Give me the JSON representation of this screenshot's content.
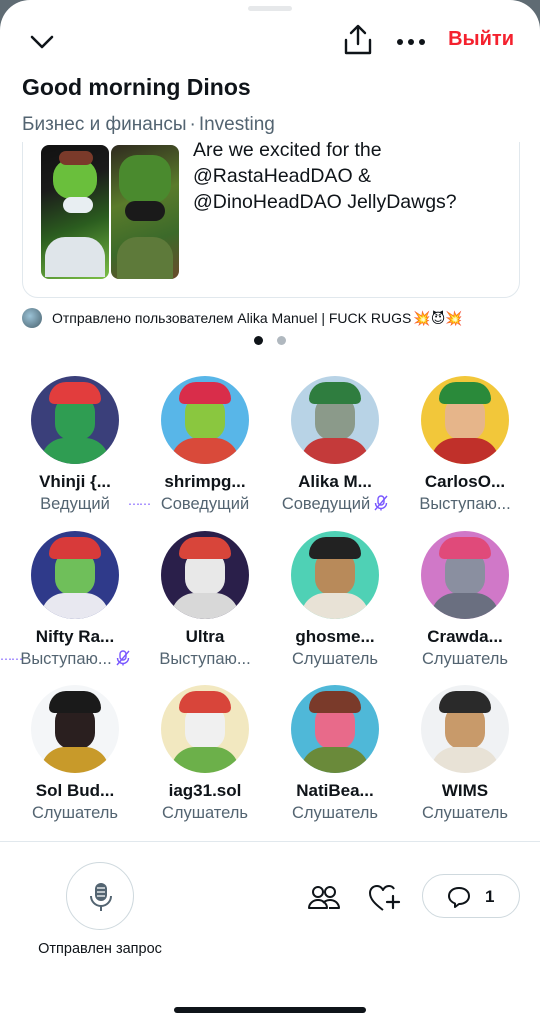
{
  "header": {
    "leave_label": "Выйти"
  },
  "space": {
    "title": "Good morning Dinos",
    "category": "Бизнес и финансы",
    "separator": "·",
    "topic": "Investing"
  },
  "pinned": {
    "text": "Are we excited for the @RastaHeadDAO & @DinoHeadDAO JellyDawgs?",
    "sent_by": "Отправлено пользователем Alika Manuel | FUCK RUGS",
    "emoji": "💥😈💥"
  },
  "carousel": {
    "pages": 2,
    "active": 1
  },
  "participants": [
    {
      "name": "Vhinji {...",
      "role": "Ведущий",
      "speaking": false,
      "muted": false
    },
    {
      "name": "shrimpg...",
      "role": "Соведущий",
      "speaking": true,
      "muted": false
    },
    {
      "name": "Alika M...",
      "role": "Соведущий",
      "speaking": false,
      "muted": true
    },
    {
      "name": "CarlosO...",
      "role": "Выступаю...",
      "speaking": false,
      "muted": false
    },
    {
      "name": "Nifty Ra...",
      "role": "Выступаю...",
      "speaking": true,
      "muted": true
    },
    {
      "name": "Ultra",
      "role": "Выступаю...",
      "speaking": false,
      "muted": false
    },
    {
      "name": "ghosme...",
      "role": "Слушатель",
      "speaking": false,
      "muted": false
    },
    {
      "name": "Crawda...",
      "role": "Слушатель",
      "speaking": false,
      "muted": false
    },
    {
      "name": "Sol Bud...",
      "role": "Слушатель",
      "speaking": false,
      "muted": false
    },
    {
      "name": "iag31.sol",
      "role": "Слушатель",
      "speaking": false,
      "muted": false
    },
    {
      "name": "NatiBea...",
      "role": "Слушатель",
      "speaking": false,
      "muted": false
    },
    {
      "name": "WIMS",
      "role": "Слушатель",
      "speaking": false,
      "muted": false
    }
  ],
  "footer": {
    "mic_label": "Отправлен запрос",
    "reply_count": "1"
  },
  "colors": {
    "leave_red": "#f4212e",
    "speaking_purple": "#7856ff",
    "secondary_text": "#536471"
  }
}
